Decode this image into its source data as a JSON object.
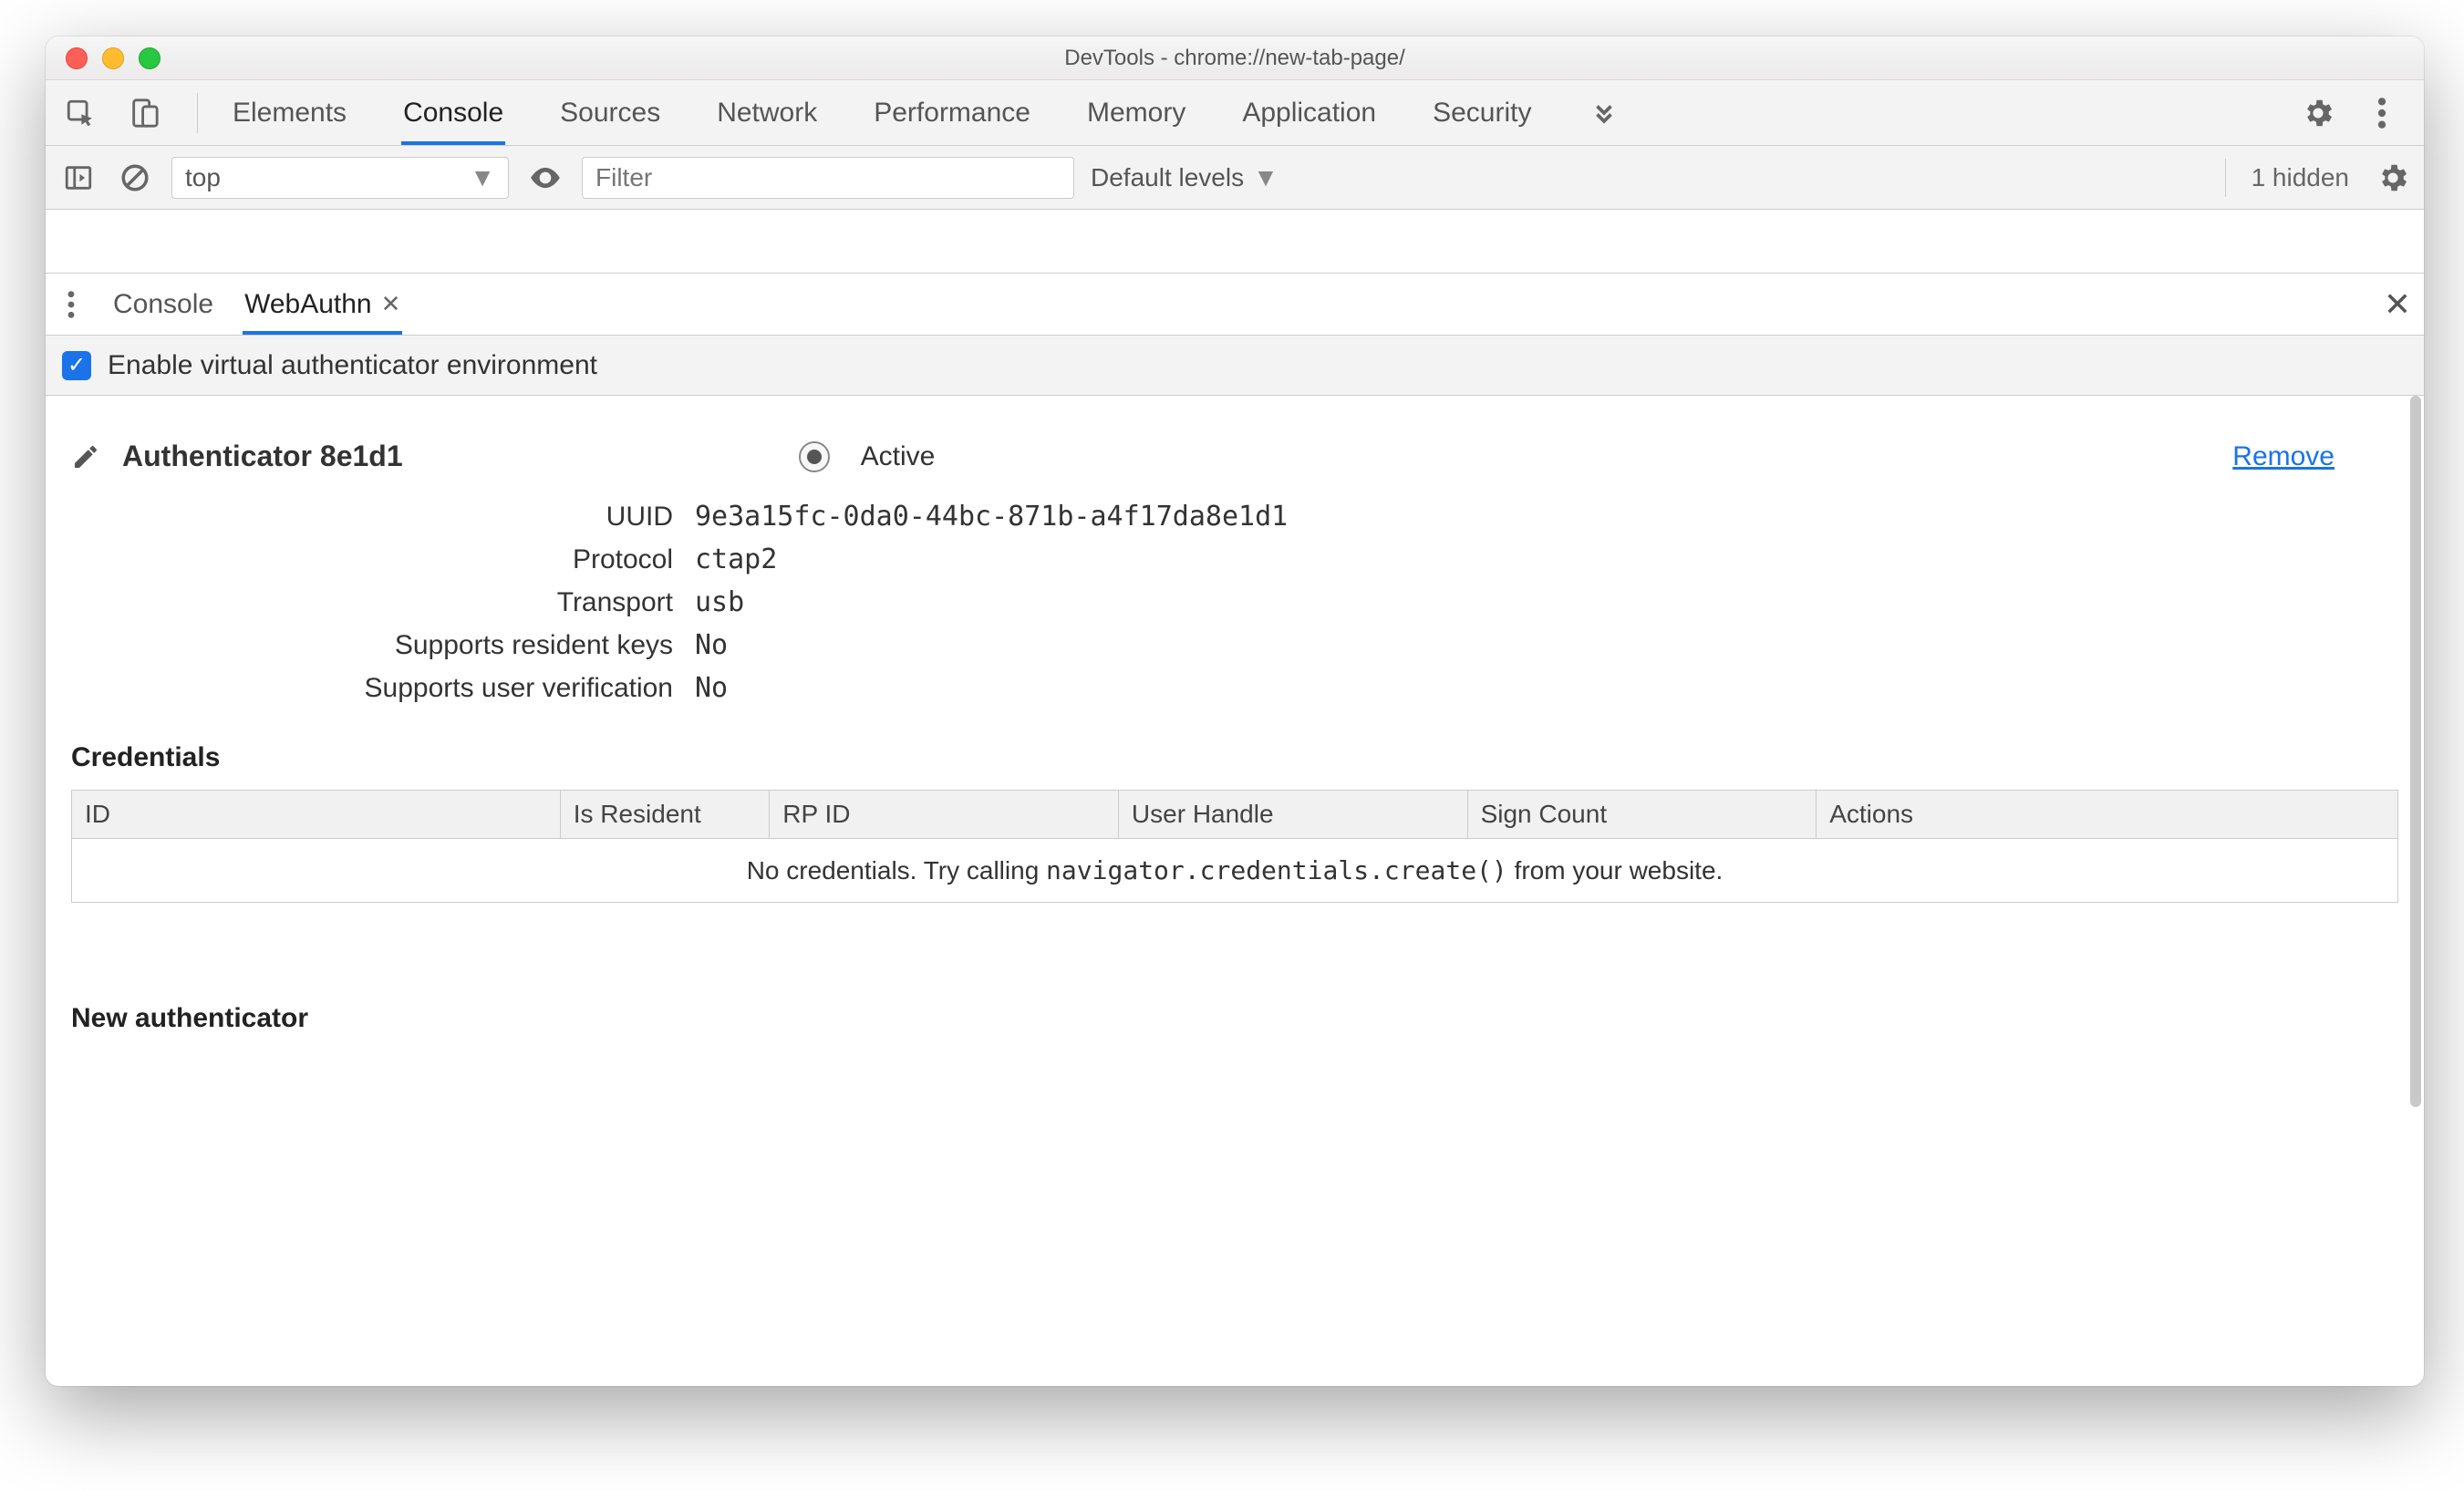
{
  "window": {
    "title": "DevTools - chrome://new-tab-page/"
  },
  "tabs": {
    "items": [
      "Elements",
      "Console",
      "Sources",
      "Network",
      "Performance",
      "Memory",
      "Application",
      "Security"
    ],
    "active": "Console"
  },
  "toolbar": {
    "context": "top",
    "filter_placeholder": "Filter",
    "levels": "Default levels",
    "hidden": "1 hidden"
  },
  "drawer": {
    "tabs": [
      "Console",
      "WebAuthn"
    ],
    "active": "WebAuthn"
  },
  "enable": {
    "label": "Enable virtual authenticator environment",
    "checked": true
  },
  "authenticator": {
    "title": "Authenticator 8e1d1",
    "active_label": "Active",
    "remove_label": "Remove",
    "fields": {
      "uuid_label": "UUID",
      "uuid": "9e3a15fc-0da0-44bc-871b-a4f17da8e1d1",
      "protocol_label": "Protocol",
      "protocol": "ctap2",
      "transport_label": "Transport",
      "transport": "usb",
      "srk_label": "Supports resident keys",
      "srk": "No",
      "suv_label": "Supports user verification",
      "suv": "No"
    }
  },
  "credentials": {
    "heading": "Credentials",
    "columns": [
      "ID",
      "Is Resident",
      "RP ID",
      "User Handle",
      "Sign Count",
      "Actions"
    ],
    "empty_pre": "No credentials. Try calling ",
    "empty_code": "navigator.credentials.create()",
    "empty_post": " from your website."
  },
  "new_auth": {
    "heading": "New authenticator"
  }
}
